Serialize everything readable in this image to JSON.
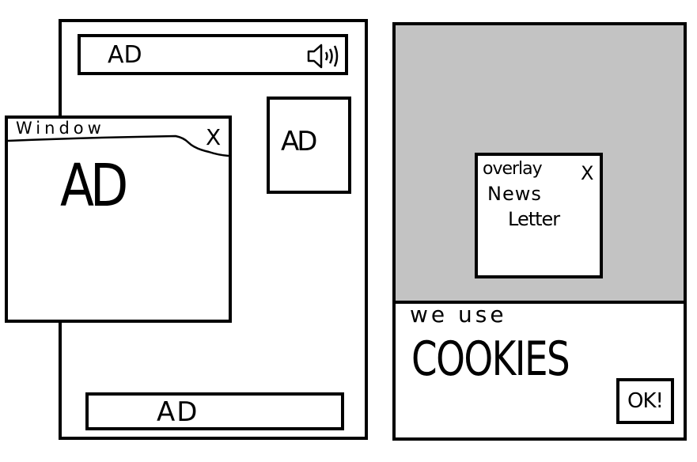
{
  "left_screen": {
    "top_banner_ad": "AD",
    "side_ad": "AD",
    "window_popup": {
      "title": "Window",
      "close": "X",
      "content": "AD"
    },
    "bottom_banner_ad": "AD"
  },
  "right_screen": {
    "overlay": {
      "title": "overlay",
      "close": "X",
      "line1": "News",
      "line2": "Letter"
    },
    "cookie_banner": {
      "line1": "we use",
      "line2": "COOKIES",
      "ok_button": "OK!"
    }
  },
  "colors": {
    "dim_backdrop": "#c3c3c3",
    "stroke": "#000000",
    "background": "#ffffff"
  },
  "icons": [
    "speaker-icon"
  ]
}
